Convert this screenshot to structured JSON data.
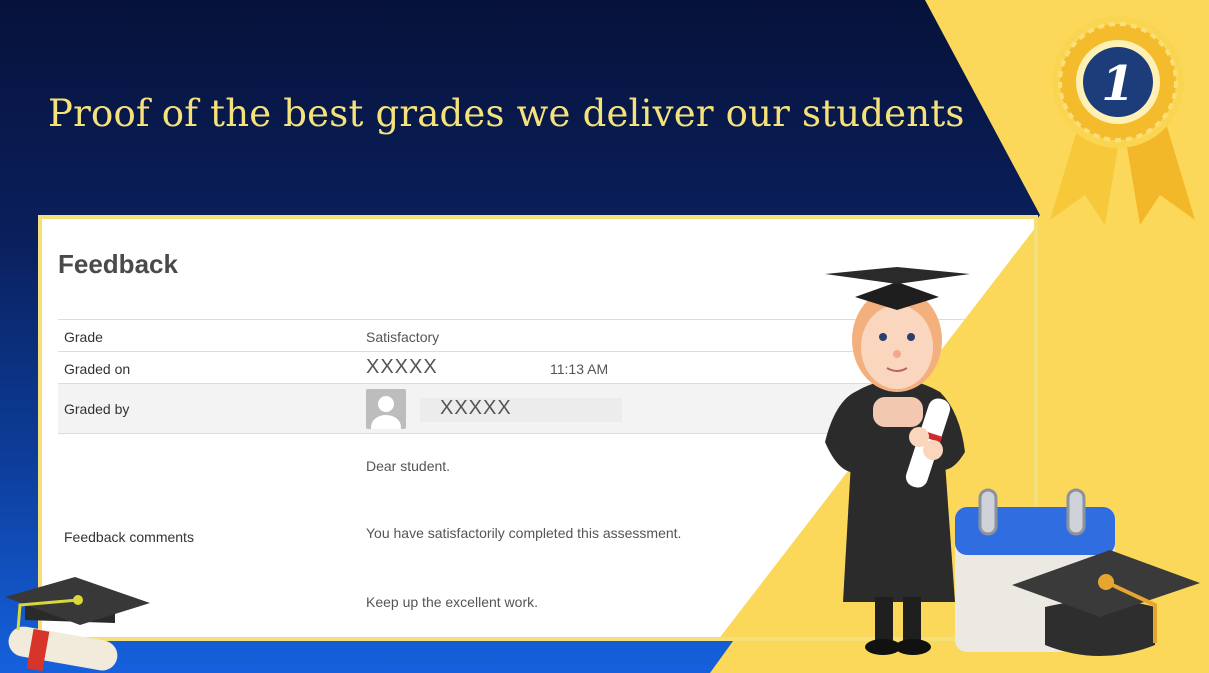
{
  "headline": "Proof of the best grades we deliver our students",
  "badge": {
    "number": "1",
    "icon": "award-ribbon-icon"
  },
  "feedback": {
    "title": "Feedback",
    "grade_label": "Grade",
    "grade_value": "Satisfactory",
    "graded_on_label": "Graded on",
    "graded_on_date": "XXXXX",
    "graded_on_time": "11:13 AM",
    "graded_by_label": "Graded by",
    "graded_by_name": "XXXXX",
    "comments_label": "Feedback comments",
    "comments": [
      "Dear student.",
      "You have satisfactorily completed this assessment.",
      "Keep up the excellent work."
    ]
  },
  "colors": {
    "accent_yellow": "#f6e27a",
    "navy": "#06123a",
    "blue": "#1561dd",
    "yellow_bg": "#fcd85a"
  }
}
